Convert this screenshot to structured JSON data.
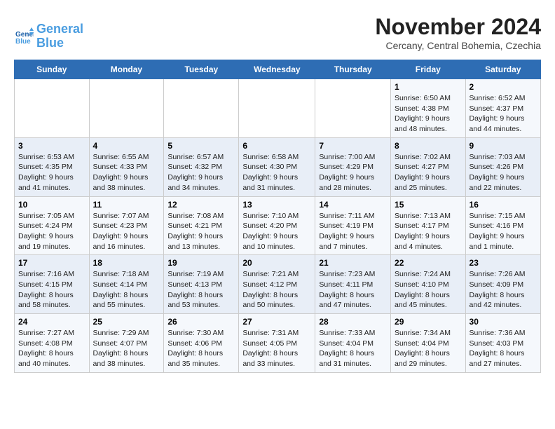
{
  "header": {
    "logo_line1": "General",
    "logo_line2": "Blue",
    "month_title": "November 2024",
    "location": "Cercany, Central Bohemia, Czechia"
  },
  "weekdays": [
    "Sunday",
    "Monday",
    "Tuesday",
    "Wednesday",
    "Thursday",
    "Friday",
    "Saturday"
  ],
  "weeks": [
    [
      {
        "day": "",
        "info": ""
      },
      {
        "day": "",
        "info": ""
      },
      {
        "day": "",
        "info": ""
      },
      {
        "day": "",
        "info": ""
      },
      {
        "day": "",
        "info": ""
      },
      {
        "day": "1",
        "info": "Sunrise: 6:50 AM\nSunset: 4:38 PM\nDaylight: 9 hours\nand 48 minutes."
      },
      {
        "day": "2",
        "info": "Sunrise: 6:52 AM\nSunset: 4:37 PM\nDaylight: 9 hours\nand 44 minutes."
      }
    ],
    [
      {
        "day": "3",
        "info": "Sunrise: 6:53 AM\nSunset: 4:35 PM\nDaylight: 9 hours\nand 41 minutes."
      },
      {
        "day": "4",
        "info": "Sunrise: 6:55 AM\nSunset: 4:33 PM\nDaylight: 9 hours\nand 38 minutes."
      },
      {
        "day": "5",
        "info": "Sunrise: 6:57 AM\nSunset: 4:32 PM\nDaylight: 9 hours\nand 34 minutes."
      },
      {
        "day": "6",
        "info": "Sunrise: 6:58 AM\nSunset: 4:30 PM\nDaylight: 9 hours\nand 31 minutes."
      },
      {
        "day": "7",
        "info": "Sunrise: 7:00 AM\nSunset: 4:29 PM\nDaylight: 9 hours\nand 28 minutes."
      },
      {
        "day": "8",
        "info": "Sunrise: 7:02 AM\nSunset: 4:27 PM\nDaylight: 9 hours\nand 25 minutes."
      },
      {
        "day": "9",
        "info": "Sunrise: 7:03 AM\nSunset: 4:26 PM\nDaylight: 9 hours\nand 22 minutes."
      }
    ],
    [
      {
        "day": "10",
        "info": "Sunrise: 7:05 AM\nSunset: 4:24 PM\nDaylight: 9 hours\nand 19 minutes."
      },
      {
        "day": "11",
        "info": "Sunrise: 7:07 AM\nSunset: 4:23 PM\nDaylight: 9 hours\nand 16 minutes."
      },
      {
        "day": "12",
        "info": "Sunrise: 7:08 AM\nSunset: 4:21 PM\nDaylight: 9 hours\nand 13 minutes."
      },
      {
        "day": "13",
        "info": "Sunrise: 7:10 AM\nSunset: 4:20 PM\nDaylight: 9 hours\nand 10 minutes."
      },
      {
        "day": "14",
        "info": "Sunrise: 7:11 AM\nSunset: 4:19 PM\nDaylight: 9 hours\nand 7 minutes."
      },
      {
        "day": "15",
        "info": "Sunrise: 7:13 AM\nSunset: 4:17 PM\nDaylight: 9 hours\nand 4 minutes."
      },
      {
        "day": "16",
        "info": "Sunrise: 7:15 AM\nSunset: 4:16 PM\nDaylight: 9 hours\nand 1 minute."
      }
    ],
    [
      {
        "day": "17",
        "info": "Sunrise: 7:16 AM\nSunset: 4:15 PM\nDaylight: 8 hours\nand 58 minutes."
      },
      {
        "day": "18",
        "info": "Sunrise: 7:18 AM\nSunset: 4:14 PM\nDaylight: 8 hours\nand 55 minutes."
      },
      {
        "day": "19",
        "info": "Sunrise: 7:19 AM\nSunset: 4:13 PM\nDaylight: 8 hours\nand 53 minutes."
      },
      {
        "day": "20",
        "info": "Sunrise: 7:21 AM\nSunset: 4:12 PM\nDaylight: 8 hours\nand 50 minutes."
      },
      {
        "day": "21",
        "info": "Sunrise: 7:23 AM\nSunset: 4:11 PM\nDaylight: 8 hours\nand 47 minutes."
      },
      {
        "day": "22",
        "info": "Sunrise: 7:24 AM\nSunset: 4:10 PM\nDaylight: 8 hours\nand 45 minutes."
      },
      {
        "day": "23",
        "info": "Sunrise: 7:26 AM\nSunset: 4:09 PM\nDaylight: 8 hours\nand 42 minutes."
      }
    ],
    [
      {
        "day": "24",
        "info": "Sunrise: 7:27 AM\nSunset: 4:08 PM\nDaylight: 8 hours\nand 40 minutes."
      },
      {
        "day": "25",
        "info": "Sunrise: 7:29 AM\nSunset: 4:07 PM\nDaylight: 8 hours\nand 38 minutes."
      },
      {
        "day": "26",
        "info": "Sunrise: 7:30 AM\nSunset: 4:06 PM\nDaylight: 8 hours\nand 35 minutes."
      },
      {
        "day": "27",
        "info": "Sunrise: 7:31 AM\nSunset: 4:05 PM\nDaylight: 8 hours\nand 33 minutes."
      },
      {
        "day": "28",
        "info": "Sunrise: 7:33 AM\nSunset: 4:04 PM\nDaylight: 8 hours\nand 31 minutes."
      },
      {
        "day": "29",
        "info": "Sunrise: 7:34 AM\nSunset: 4:04 PM\nDaylight: 8 hours\nand 29 minutes."
      },
      {
        "day": "30",
        "info": "Sunrise: 7:36 AM\nSunset: 4:03 PM\nDaylight: 8 hours\nand 27 minutes."
      }
    ]
  ]
}
